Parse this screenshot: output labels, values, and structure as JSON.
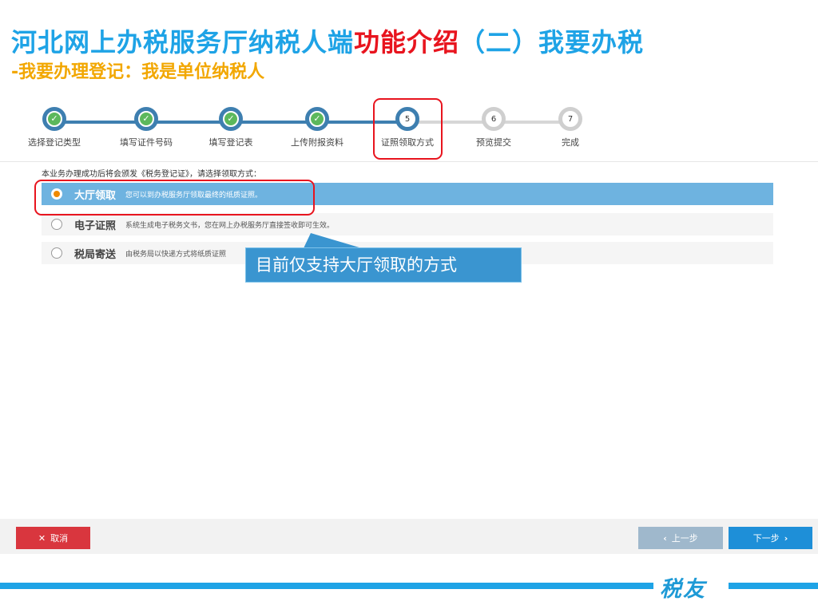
{
  "title": {
    "part1": "河北网上办税服务厅纳税人端",
    "part2": "功能介绍",
    "part3": "（二）我要办税",
    "subtitle": "-我要办理登记：我是单位纳税人"
  },
  "steps": [
    {
      "num": "",
      "label": "选择登记类型",
      "state": "done"
    },
    {
      "num": "",
      "label": "填写证件号码",
      "state": "done"
    },
    {
      "num": "",
      "label": "填写登记表",
      "state": "done"
    },
    {
      "num": "",
      "label": "上传附报资料",
      "state": "done"
    },
    {
      "num": "5",
      "label": "证照领取方式",
      "state": "active"
    },
    {
      "num": "6",
      "label": "预览提交",
      "state": "todo"
    },
    {
      "num": "7",
      "label": "完成",
      "state": "todo"
    }
  ],
  "instruction": "本业务办理成功后将会颁发《税务登记证》，请选择领取方式：",
  "options": [
    {
      "name": "大厅领取",
      "desc": "您可以到办税服务厅领取最终的纸质证照。",
      "selected": true
    },
    {
      "name": "电子证照",
      "desc": "系统生成电子税务文书，您在网上办税服务厅直接签收即可生效。",
      "selected": false
    },
    {
      "name": "税局寄送",
      "desc": "由税务局以快递方式将纸质证照",
      "selected": false
    }
  ],
  "callout": "目前仅支持大厅领取的方式",
  "buttons": {
    "cancel": "取消",
    "prev": "上一步",
    "next": "下一步"
  },
  "brand": "税友",
  "colors": {
    "primary_blue": "#1ea3e6",
    "highlight_red": "#e8141e",
    "subtitle_gold": "#f2a700",
    "selected_row": "#6eb3e0",
    "cancel_red": "#d9363e",
    "next_blue": "#1e8fd8"
  },
  "icons": {
    "done_step": "check-icon",
    "cancel": "close-icon",
    "prev": "chevron-left-icon",
    "next": "chevron-right-icon"
  }
}
